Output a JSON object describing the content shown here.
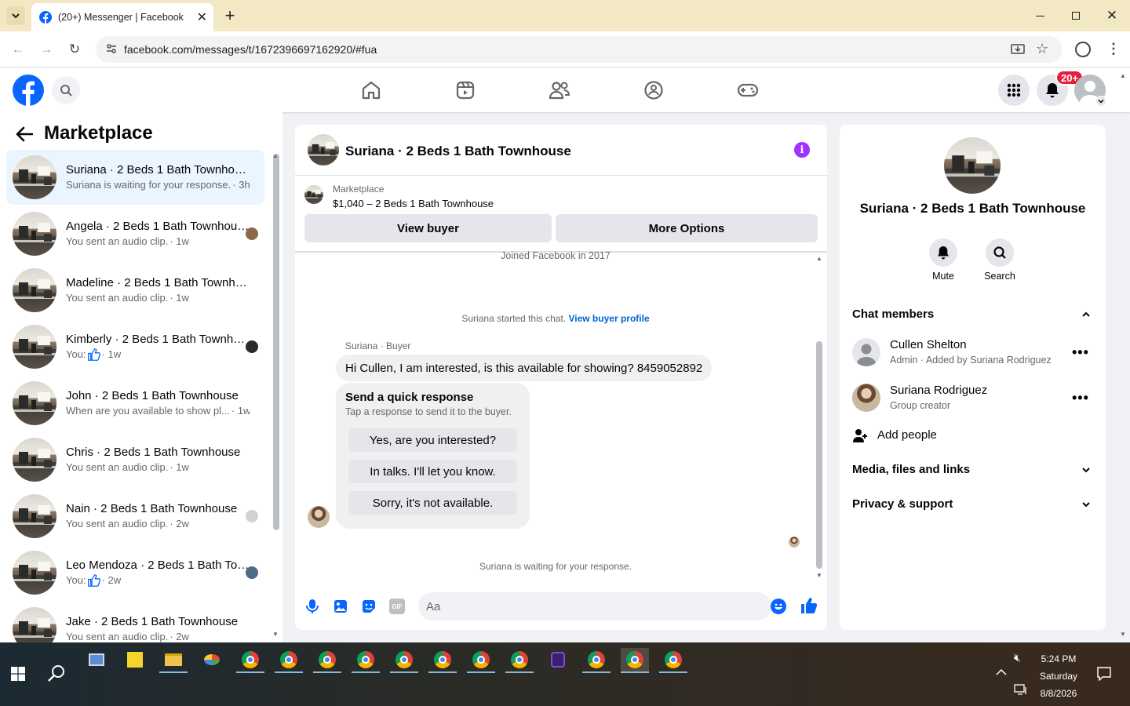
{
  "browser": {
    "tab_title": "(20+) Messenger | Facebook",
    "url": "facebook.com/messages/t/1672396697162920/#fua"
  },
  "header": {
    "notification_count": "20+"
  },
  "left": {
    "title": "Marketplace",
    "conversations": [
      {
        "title": "Suriana · 2 Beds 1 Bath Townhouse",
        "snippet": "Suriana is waiting for your response.",
        "time": "· 3h",
        "active": true
      },
      {
        "title": "Angela · 2 Beds 1 Bath Townhouse",
        "snippet": "You sent an audio clip.",
        "time": "· 1w"
      },
      {
        "title": "Madeline · 2 Beds 1 Bath Townhouse",
        "snippet": "You sent an audio clip.",
        "time": "· 1w"
      },
      {
        "title": "Kimberly · 2 Beds 1 Bath Townhouse",
        "snippet": "You:",
        "time": "· 1w",
        "like": true
      },
      {
        "title": "John · 2 Beds 1 Bath Townhouse",
        "snippet": "When are you available to show pl...",
        "time": "· 1w"
      },
      {
        "title": "Chris · 2 Beds 1 Bath Townhouse",
        "snippet": "You sent an audio clip.",
        "time": "· 1w"
      },
      {
        "title": "Nain · 2 Beds 1 Bath Townhouse",
        "snippet": "You sent an audio clip.",
        "time": "· 2w"
      },
      {
        "title": "Leo Mendoza · 2 Beds 1 Bath Townhouse",
        "snippet": "You:",
        "time": "· 2w",
        "like": true
      },
      {
        "title": "Jake · 2 Beds 1 Bath Townhouse",
        "snippet": "You sent an audio clip.",
        "time": "· 2w"
      }
    ]
  },
  "chat": {
    "title": "Suriana · 2 Beds 1 Bath Townhouse",
    "listing_label": "Marketplace",
    "listing_price": "$1,040 – 2 Beds 1 Bath Townhouse",
    "view_buyer": "View buyer",
    "more_options": "More Options",
    "joined": "Joined Facebook in 2017",
    "started": "Suriana started this chat.",
    "view_profile": "View buyer profile",
    "sender": "Suriana · Buyer",
    "message": "Hi Cullen, I am interested, is this available for showing? 8459052892",
    "quick_title": "Send a quick response",
    "quick_sub": "Tap a response to send it to the buyer.",
    "quick_replies": [
      "Yes, are you interested?",
      "In talks. I'll let you know.",
      "Sorry, it's not available."
    ],
    "waiting": "Suriana is waiting for your response.",
    "input_placeholder": "Aa"
  },
  "details": {
    "title": "Suriana · 2 Beds 1 Bath Townhouse",
    "mute": "Mute",
    "search": "Search",
    "members_header": "Chat members",
    "members": [
      {
        "name": "Cullen Shelton",
        "role": "Admin · Added by Suriana Rodriguez"
      },
      {
        "name": "Suriana Rodriguez",
        "role": "Group creator"
      }
    ],
    "add_people": "Add people",
    "media": "Media, files and links",
    "privacy": "Privacy & support"
  },
  "taskbar": {
    "time": "5:24 PM",
    "day": "Saturday",
    "date": "8/8/2026"
  },
  "colors": {
    "fb_blue": "#0866ff",
    "link_blue": "#0064d1",
    "purple": "#a033ff",
    "badge_red": "#e41e3f"
  }
}
